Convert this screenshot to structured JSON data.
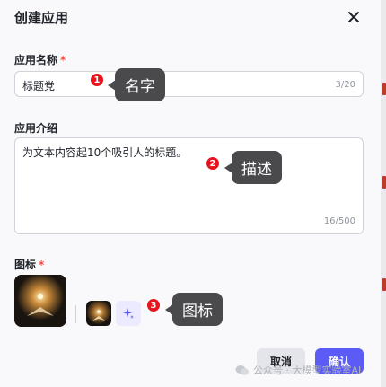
{
  "dialog": {
    "title": "创建应用",
    "name_label": "应用名称",
    "name_required": "*",
    "name_value": "标题党",
    "name_count": "3/20",
    "desc_label": "应用介绍",
    "desc_value": "为文本内容起10个吸引人的标题。",
    "desc_count": "16/500",
    "icon_label": "图标",
    "icon_required": "*",
    "cancel_label": "取消",
    "ok_label": "确认"
  },
  "annotations": [
    {
      "number": "1",
      "text": "名字"
    },
    {
      "number": "2",
      "text": "描述"
    },
    {
      "number": "3",
      "text": "图标"
    }
  ],
  "watermark": "公众号 · 大模型实验室AI",
  "colors": {
    "accent": "#5b5cf5",
    "required": "#f54a45",
    "badge": "#e8141e",
    "callout": "#4a4a4d"
  }
}
